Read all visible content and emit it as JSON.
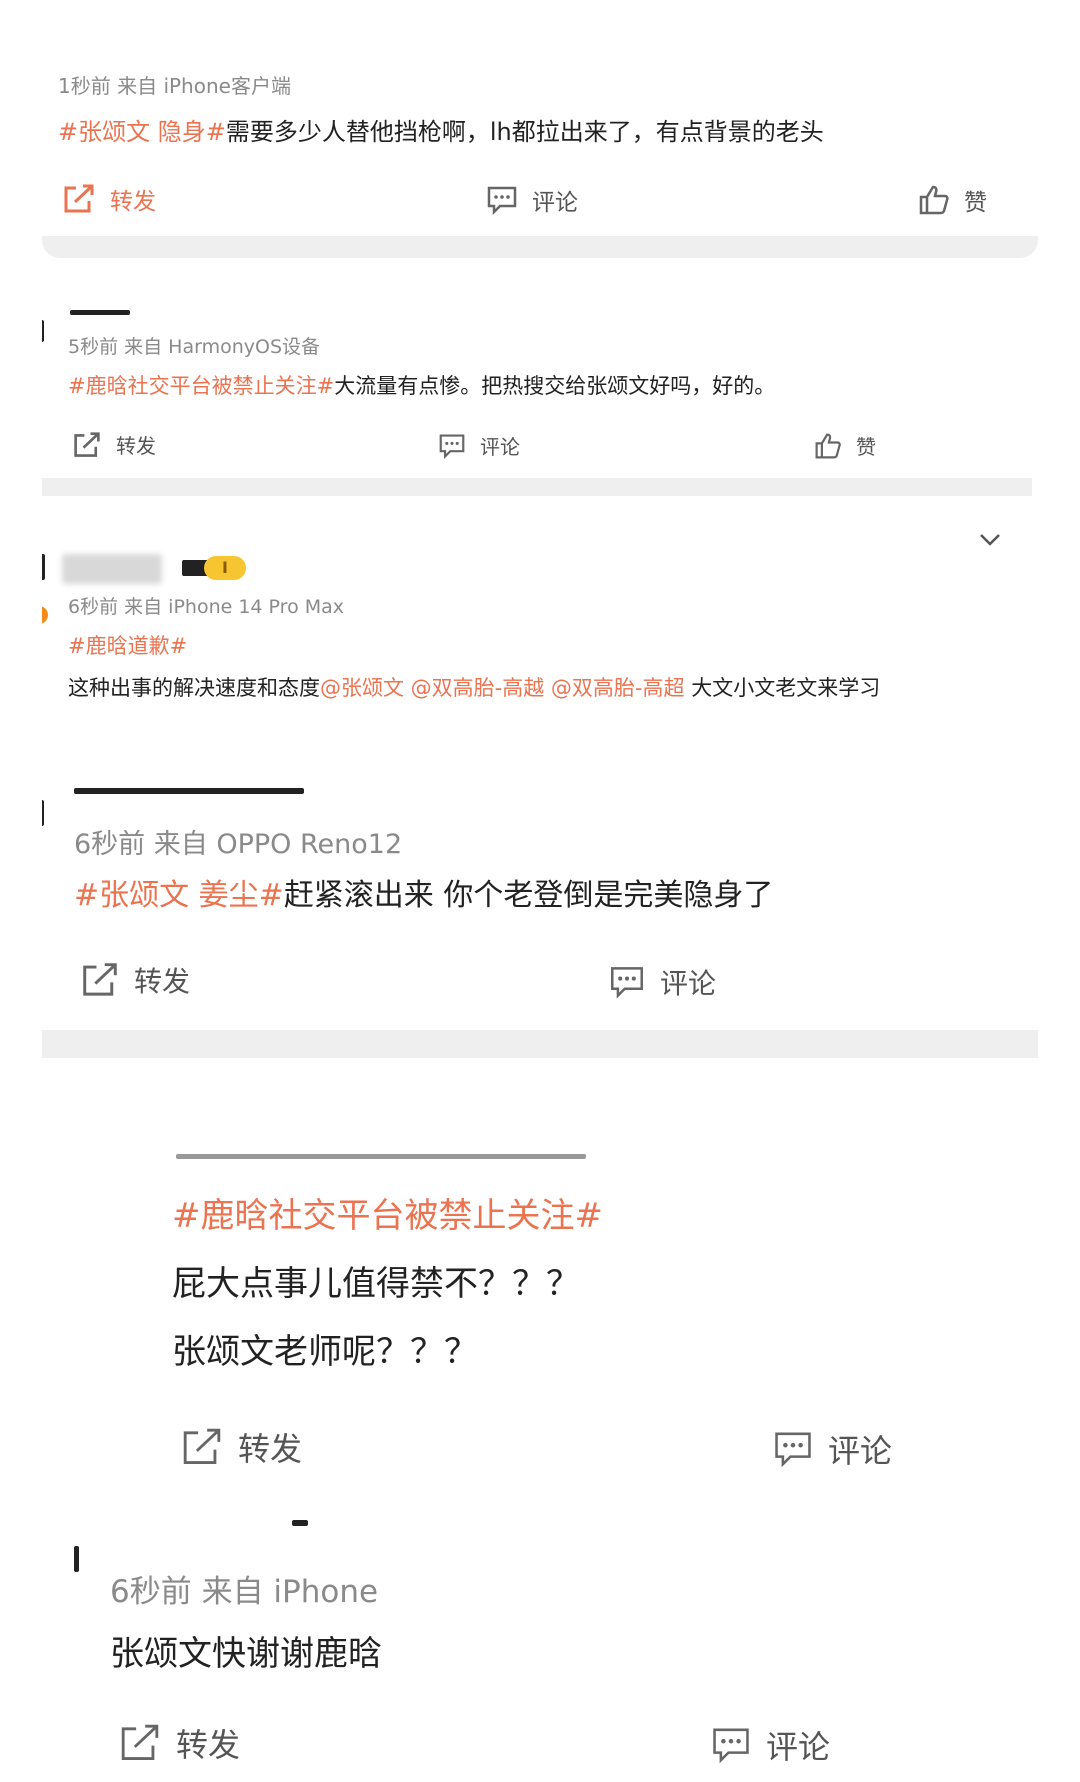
{
  "posts": [
    {
      "meta": "1秒前  来自 iPhone客户端",
      "tag": "#张颂文 隐身#",
      "text": "需要多少人替他挡枪啊，lh都拉出来了，有点背景的老头",
      "actions": {
        "repost": "转发",
        "comment": "评论",
        "like": "赞"
      }
    },
    {
      "meta": "5秒前  来自 HarmonyOS设备",
      "tag": "#鹿晗社交平台被禁止关注#",
      "text": "大流量有点惨。把热搜交给张颂文好吗，好的。",
      "actions": {
        "repost": "转发",
        "comment": "评论",
        "like": "赞"
      }
    },
    {
      "meta": "6秒前  来自 iPhone 14 Pro Max",
      "tag": "#鹿晗道歉#",
      "text_before": "这种出事的解决速度和态度",
      "mentions": "@张颂文 @双高胎-高越 @双高胎-高超",
      "text_after": " 大文小文老文来学习"
    },
    {
      "meta": "6秒前  来自 OPPO Reno12",
      "tag": "#张颂文 姜尘#",
      "text": "赶紧滚出来 你个老登倒是完美隐身了",
      "actions": {
        "repost": "转发",
        "comment": "评论"
      }
    },
    {
      "tag": "#鹿晗社交平台被禁止关注#",
      "line1": "屁大点事儿值得禁不？？？",
      "line2": "张颂文老师呢？？？",
      "actions": {
        "repost": "转发",
        "comment": "评论"
      }
    },
    {
      "meta": "6秒前  来自 iPhone",
      "text": "张颂文快谢谢鹿晗",
      "actions": {
        "repost": "转发",
        "comment": "评论"
      }
    }
  ],
  "colors": {
    "accent": "#eb7350",
    "meta": "#8a8a8a",
    "text": "#222222"
  }
}
